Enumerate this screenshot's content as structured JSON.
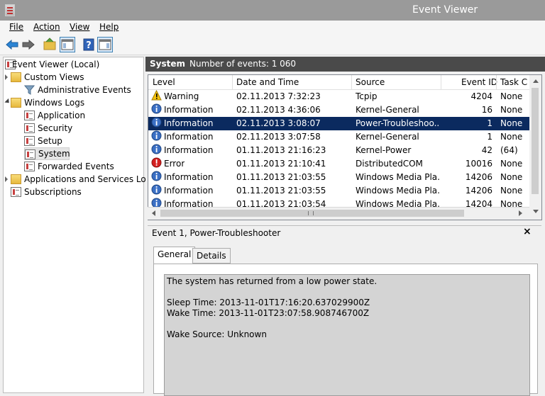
{
  "window": {
    "title": "Event Viewer"
  },
  "menu": {
    "file": "File",
    "action": "Action",
    "view": "View",
    "help": "Help"
  },
  "toolbar": {
    "buttons": [
      "back-icon",
      "forward-icon",
      "up-folder-icon",
      "show-hide-console-tree-icon",
      "help-icon",
      "show-hide-action-pane-icon"
    ]
  },
  "tree": {
    "root": "Event Viewer (Local)",
    "custom_views": "Custom Views",
    "administrative_events": "Administrative Events",
    "windows_logs": "Windows Logs",
    "application": "Application",
    "security": "Security",
    "setup": "Setup",
    "system": "System",
    "forwarded_events": "Forwarded Events",
    "apps_services_logs": "Applications and Services Logs",
    "subscriptions": "Subscriptions"
  },
  "header": {
    "log_name": "System",
    "count_text": "Number of events: 1 060"
  },
  "table": {
    "columns": [
      "Level",
      "Date and Time",
      "Source",
      "Event ID",
      "Task C"
    ],
    "rows": [
      {
        "level": "Warning",
        "icon": "warning-icon",
        "datetime": "02.11.2013 7:32:23",
        "source": "Tcpip",
        "event_id": "4204",
        "task": "None"
      },
      {
        "level": "Information",
        "icon": "info-icon",
        "datetime": "02.11.2013 4:36:06",
        "source": "Kernel-General",
        "event_id": "16",
        "task": "None"
      },
      {
        "level": "Information",
        "icon": "info-icon",
        "datetime": "02.11.2013 3:08:07",
        "source": "Power-Troubleshoo...",
        "event_id": "1",
        "task": "None"
      },
      {
        "level": "Information",
        "icon": "info-icon",
        "datetime": "02.11.2013 3:07:58",
        "source": "Kernel-General",
        "event_id": "1",
        "task": "None"
      },
      {
        "level": "Information",
        "icon": "info-icon",
        "datetime": "01.11.2013 21:16:23",
        "source": "Kernel-Power",
        "event_id": "42",
        "task": "(64)"
      },
      {
        "level": "Error",
        "icon": "error-icon",
        "datetime": "01.11.2013 21:10:41",
        "source": "DistributedCOM",
        "event_id": "10016",
        "task": "None"
      },
      {
        "level": "Information",
        "icon": "info-icon",
        "datetime": "01.11.2013 21:03:55",
        "source": "Windows Media Pla...",
        "event_id": "14206",
        "task": "None"
      },
      {
        "level": "Information",
        "icon": "info-icon",
        "datetime": "01.11.2013 21:03:55",
        "source": "Windows Media Pla...",
        "event_id": "14206",
        "task": "None"
      },
      {
        "level": "Information",
        "icon": "info-icon",
        "datetime": "01.11.2013 21:03:54",
        "source": "Windows Media Pla...",
        "event_id": "14204",
        "task": "None"
      }
    ]
  },
  "details": {
    "title": "Event 1, Power-Troubleshooter",
    "tabs": [
      "General",
      "Details"
    ],
    "message": {
      "line1": "The system has returned from a low power state.",
      "line2": "Sleep Time: 2013-11-01T17:16:20.637029900Z",
      "line3": "Wake Time: 2013-11-01T23:07:58.908746700Z",
      "line4": "Wake Source: Unknown"
    }
  },
  "colors": {
    "selection": "#0b2a5f",
    "header_bg": "#4a4a4a",
    "titlebar_bg": "#9a9a9a"
  }
}
